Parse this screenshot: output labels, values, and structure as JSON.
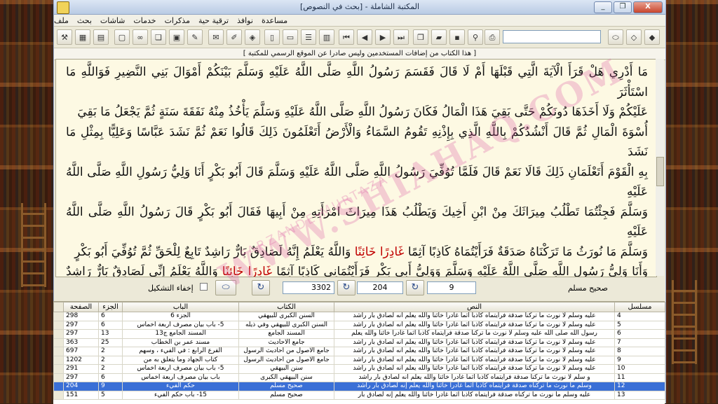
{
  "window": {
    "title": "المكتبة الشاملة - [بحث في النصوص]",
    "controls": [
      "_",
      "❐",
      "X"
    ]
  },
  "menu": [
    "ملف",
    "بحث",
    "شاشات",
    "خدمات",
    "مذكرات",
    "ترقية حية",
    "نوافذ",
    "مساعدة"
  ],
  "infobar": "[ هذا الكتاب من إضافات المستخدمين وليس صادرا عن الموقع الرسمي للمكتبة ]",
  "text_lines": [
    "مَا أَدْرِي هَلْ قَرَأَ الْآيَةَ الَّتِي قَبْلَهَا أَمْ لَا قَالَ فَقَسَمَ رَسُولُ اللَّهِ صَلَّى اللَّهُ عَلَيْهِ وَسَلَّمَ بَيْنَكُمْ أَمْوَالَ بَنِي النَّضِيرِ فَوَاللَّهِ مَا اسْتَأْثَرَ",
    "عَلَيْكُمْ وَلَا أَخَذَهَا دُونَكُمْ حَتَّى بَقِيَ هَذَا الْمَالُ فَكَانَ رَسُولُ اللَّهِ صَلَّى اللَّهُ عَلَيْهِ وَسَلَّمَ يَأْخُذُ مِنْهُ نَفَقَةَ سَنَةٍ ثُمَّ يَجْعَلُ مَا بَقِيَ",
    "أُسْوَةَ الْمَالِ ثُمَّ قَالَ أَنْشُدُكُمْ بِاللَّهِ الَّذِي بِإِذْنِهِ تَقُومُ السَّمَاءُ وَالْأَرْضُ أَتَعْلَمُونَ ذَلِكَ قَالُوا نَعَمْ ثُمَّ نَشَدَ عَبَّاسًا وَعَلِيًّا بِمِثْلِ مَا نَشَدَ",
    "بِهِ الْقَوْمَ أَتَعْلَمَانِ ذَلِكَ قَالَا نَعَمْ قَالَ فَلَمَّا تُوُفِّيَ رَسُولُ اللَّهِ صَلَّى اللَّهُ عَلَيْهِ وَسَلَّمَ قَالَ أَبُو بَكْرٍ أَنَا وَلِيُّ رَسُولِ اللَّهِ صَلَّى اللَّهُ عَلَيْهِ",
    "وَسَلَّمَ فَجِئْتُمَا تَطْلُبُ مِيرَاثَكَ مِنْ ابْنِ أَخِيكَ وَيَطْلُبُ هَذَا مِيرَاثَ امْرَأَتِهِ مِنْ أَبِيهَا فَقَالَ أَبُو بَكْرٍ قَالَ رَسُولُ اللَّهِ صَلَّى اللَّهُ عَلَيْهِ",
    "وَسَلَّمَ مَا نُورَثُ مَا تَرَكْنَاهُ صَدَقَةٌ فَرَأَيْتُمَاهُ كَاذِبًا آثِمًا غَادِرًا خَائِنًا وَاللَّهُ يَعْلَمُ إِنَّهُ لَصَادِقٌ بَارٌّ رَاشِدٌ تَابِعٌ لِلْحَقِّ ثُمَّ تُوُفِّيَ أَبُو بَكْرٍ",
    "وَأَنَا وَلِيُّ رَسُولِ اللَّهِ صَلَّى اللَّهُ عَلَيْهِ وَسَلَّمَ وَوَلِيُّ أَبِي بَكْرٍ فَرَأَيْتُمَانِي كَاذِبًا آثِمًا غَادِرًا خَائِنًا وَاللَّهُ يَعْلَمُ إِنِّي لَصَادِقٌ بَارٌّ رَاشِدٌ تَابِعٌ",
    "لِلْحَقِّ فَوَلِيتُهَا ثُمَّ جِئْتَنِي أَنْتَ وَهَذَا وَأَنْتُمَا جَمِيعٌ وَأَمْرُكُمَا وَاحِدٌ فَقُلْتُمَا ادْفَعْهَا إِلَيْنَا فَقُلْتُ إِنْ شِئْتُمْ دَفَعْتُهَا إِلَيْكُمَا عَلَى أَنَّ"
  ],
  "highlight_words": [
    "غَادِرًا خَائِنًا"
  ],
  "nav": {
    "book_name": "صحيح مسلم",
    "field_a": "9",
    "field_b": "204",
    "field_c": "3302",
    "hide_diacritics_label": "إخفاء التشكيل"
  },
  "table": {
    "headers": [
      "الصفحة",
      "الجزء",
      "الباب",
      "الكتاب",
      "النص",
      "مسلسل"
    ],
    "rows": [
      [
        "298",
        "6",
        "الجزء 6",
        "السنن الكبرى للبيهقي",
        "عليه وسلم لا نورث ما تركنا صدقة فرأيتماه كاذبا آثما غادرا خائنا والله يعلم أنه لصادق بار راشد",
        "4"
      ],
      [
        "297",
        "6",
        "5- باب بيان مصرف أربعة أخماس",
        "السنن الكبرى للبيهقي وفي ذيله",
        "عليه وسلم لا نورث ما تركنا صدقة فرأيتماه كاذبا آثما غادرا خائنا والله يعلم أنه لصادق بار راشد",
        "5"
      ],
      [
        "297",
        "13",
        "المسند الجامع ج13",
        "المسند الجامع",
        "رسول الله صلى الله عليه وسلم لا نورث ما تركنا صدقة فرأيتماه كاذبا آثما غادرا خائنا والله يعلم",
        "6"
      ],
      [
        "363",
        "25",
        "مسند عمر بن الخطاب",
        "جامع الأحاديث",
        "عليه وسلم لا نورث ما تركنا صدقة فرأيتماه كاذبا آثما غادرا خائنا والله يعلم أنه لصادق بار راشد",
        "7"
      ],
      [
        "697",
        "2",
        "الفرع الرابع : في الفيء ، وسهم",
        "جامع الأصول من أحاديث الرسول",
        "عليه وسلم لا نورث ما تركنا صدقة فرأيتماه كاذبا آثما غادرا خائنا والله يعلم أنه لصادق بار راشد",
        "8"
      ],
      [
        "1202",
        "2",
        "كتاب الجهاد وما يتعلق به من",
        "جامع الأصول من أحاديث الرسول",
        "عليه وسلم لا نورث ما تركنا صدقة فرأيتماه كاذبا آثما غادرا خائنا والله يعلم أنه لصادق بار راشد",
        "9"
      ],
      [
        "291",
        "2",
        "5- باب بيان مصرف أربعة أخماس",
        "سنن البيهقي",
        "عليه وسلم لا نورث ما تركنا صدقة فرأيتماه كاذبا آثما غادرا خائنا والله يعلم أنه لصادق بار راشد",
        "10"
      ],
      [
        "297",
        "6",
        "باب بيان مصرف أربعة أخماس",
        "سنن البيهقي الكبرى",
        "و سلم لا نورث ما تركنا صدقة فرأيتماه كاذبا آثما غادرا خائنا والله يعلم أنه لصادق بار راشد",
        "11"
      ],
      [
        "204",
        "9",
        "حكم الفيء",
        "صحيح مسلم",
        "وسلم ما نورث ما تركناه صدقة فرأيتماه كاذبا آثما غادرا خائنا والله يعلم إنه لصادق بار راشد",
        "12"
      ],
      [
        "151",
        "5",
        "15- باب حكم الفيء",
        "صحيح مسلم",
        "عليه وسلم ما نورث ما تركناه صدقة فرأيتماه كاذبا آثما غادرا خائنا والله يعلم إنه لصادق بار",
        "13"
      ]
    ],
    "selected_index": 8
  },
  "watermark": {
    "main": "WWW.SHIAHAQ.COM",
    "sub": "FARZANDE MURTAZA"
  },
  "colors": {
    "text_bg": "#fdf9e3",
    "highlight": "#c00000",
    "selected_row": "#3a6fd6"
  }
}
